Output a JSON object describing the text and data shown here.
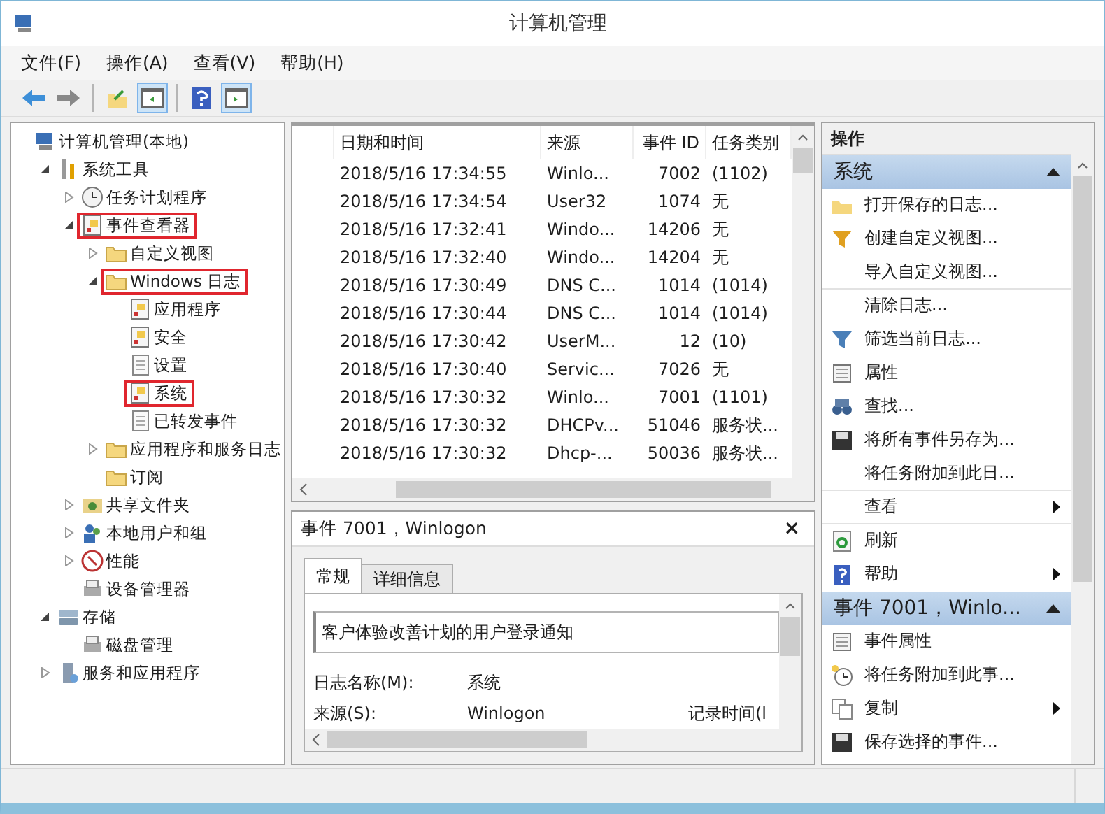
{
  "window": {
    "title": "计算机管理"
  },
  "menu": [
    "文件(F)",
    "操作(A)",
    "查看(V)",
    "帮助(H)"
  ],
  "toolbar": [
    [
      {
        "kind": "back",
        "pressed": false
      },
      {
        "kind": "forward",
        "pressed": false
      }
    ],
    [
      {
        "kind": "up",
        "pressed": false
      },
      {
        "kind": "tree",
        "pressed": true
      }
    ],
    [
      {
        "kind": "help",
        "pressed": false
      },
      {
        "kind": "pane",
        "pressed": true
      }
    ]
  ],
  "tree": [
    {
      "label": "计算机管理(本地)",
      "kind": "computer",
      "highlighted": false,
      "children": [
        {
          "label": "系统工具",
          "kind": "tools",
          "expanded": true,
          "highlighted": false,
          "children": [
            {
              "label": "任务计划程序",
              "kind": "clock",
              "expanded": false,
              "highlighted": false
            },
            {
              "label": "事件查看器",
              "kind": "log",
              "expanded": true,
              "highlighted": true,
              "children": [
                {
                  "label": "自定义视图",
                  "kind": "folder",
                  "expanded": false,
                  "highlighted": false
                },
                {
                  "label": "Windows 日志",
                  "kind": "folder",
                  "expanded": true,
                  "highlighted": true,
                  "children": [
                    {
                      "label": "应用程序",
                      "kind": "log",
                      "highlighted": false
                    },
                    {
                      "label": "安全",
                      "kind": "log",
                      "highlighted": false
                    },
                    {
                      "label": "设置",
                      "kind": "sheet",
                      "highlighted": false
                    },
                    {
                      "label": "系统",
                      "kind": "log",
                      "highlighted": true
                    },
                    {
                      "label": "已转发事件",
                      "kind": "sheet",
                      "highlighted": false
                    }
                  ]
                },
                {
                  "label": "应用程序和服务日志",
                  "kind": "folder",
                  "expanded": false,
                  "highlighted": false
                },
                {
                  "label": "订阅",
                  "kind": "folder",
                  "highlighted": false
                }
              ]
            },
            {
              "label": "共享文件夹",
              "kind": "share",
              "expanded": false,
              "highlighted": false
            },
            {
              "label": "本地用户和组",
              "kind": "users",
              "expanded": false,
              "highlighted": false
            },
            {
              "label": "性能",
              "kind": "perf",
              "expanded": false,
              "highlighted": false
            },
            {
              "label": "设备管理器",
              "kind": "device",
              "highlighted": false
            }
          ]
        },
        {
          "label": "存储",
          "kind": "storage",
          "expanded": true,
          "highlighted": false,
          "children": [
            {
              "label": "磁盘管理",
              "kind": "device",
              "highlighted": false
            }
          ]
        },
        {
          "label": "服务和应用程序",
          "kind": "server",
          "expanded": false,
          "highlighted": false
        }
      ]
    }
  ],
  "table": {
    "columns": [
      "日期和时间",
      "来源",
      "事件 ID",
      "任务类别"
    ],
    "rows": [
      [
        "2018/5/16 17:34:55",
        "Winlo...",
        "7002",
        "(1102)"
      ],
      [
        "2018/5/16 17:34:54",
        "User32",
        "1074",
        "无"
      ],
      [
        "2018/5/16 17:32:41",
        "Windo...",
        "14206",
        "无"
      ],
      [
        "2018/5/16 17:32:40",
        "Windo...",
        "14204",
        "无"
      ],
      [
        "2018/5/16 17:30:49",
        "DNS C...",
        "1014",
        "(1014)"
      ],
      [
        "2018/5/16 17:30:44",
        "DNS C...",
        "1014",
        "(1014)"
      ],
      [
        "2018/5/16 17:30:42",
        "UserM...",
        "12",
        "(10)"
      ],
      [
        "2018/5/16 17:30:40",
        "Servic...",
        "7026",
        "无"
      ],
      [
        "2018/5/16 17:30:32",
        "Winlo...",
        "7001",
        "(1101)"
      ],
      [
        "2018/5/16 17:30:32",
        "DHCPv...",
        "51046",
        "服务状..."
      ],
      [
        "2018/5/16 17:30:32",
        "Dhcp-...",
        "50036",
        "服务状..."
      ]
    ]
  },
  "detail": {
    "title": "事件 7001，Winlogon",
    "close": "×",
    "tabs": [
      {
        "label": "常规",
        "selected": true
      },
      {
        "label": "详细信息",
        "selected": false
      }
    ],
    "description": "客户体验改善计划的用户登录通知",
    "fields": [
      {
        "label": "日志名称(M):",
        "value": "系统"
      },
      {
        "label": "来源(S):",
        "value": "Winlogon",
        "extra": "记录时间(l"
      }
    ]
  },
  "actions": {
    "title": "操作",
    "sections": [
      {
        "title": "系统",
        "items": [
          {
            "label": "打开保存的日志...",
            "kind": "open",
            "submenu": false,
            "separator_after": false
          },
          {
            "label": "创建自定义视图...",
            "kind": "filter",
            "submenu": false,
            "separator_after": false
          },
          {
            "label": "导入自定义视图...",
            "kind": "none",
            "submenu": false,
            "separator_after": true
          },
          {
            "label": "清除日志...",
            "kind": "none",
            "submenu": false,
            "separator_after": false
          },
          {
            "label": "筛选当前日志...",
            "kind": "filter2",
            "submenu": false,
            "separator_after": false
          },
          {
            "label": "属性",
            "kind": "props",
            "submenu": false,
            "separator_after": false
          },
          {
            "label": "查找...",
            "kind": "find",
            "submenu": false,
            "separator_after": false
          },
          {
            "label": "将所有事件另存为...",
            "kind": "save",
            "submenu": false,
            "separator_after": false
          },
          {
            "label": "将任务附加到此日...",
            "kind": "none",
            "submenu": false,
            "separator_after": true
          },
          {
            "label": "查看",
            "kind": "none",
            "submenu": true,
            "separator_after": true
          },
          {
            "label": "刷新",
            "kind": "refresh",
            "submenu": false,
            "separator_after": false
          },
          {
            "label": "帮助",
            "kind": "help",
            "submenu": true,
            "separator_after": false
          }
        ]
      },
      {
        "title": "事件 7001，Winlo...",
        "items": [
          {
            "label": "事件属性",
            "kind": "props",
            "submenu": false,
            "separator_after": false
          },
          {
            "label": "将任务附加到此事...",
            "kind": "task",
            "submenu": false,
            "separator_after": false
          },
          {
            "label": "复制",
            "kind": "copy",
            "submenu": true,
            "separator_after": false
          },
          {
            "label": "保存选择的事件...",
            "kind": "save",
            "submenu": false,
            "separator_after": false
          }
        ]
      }
    ]
  }
}
